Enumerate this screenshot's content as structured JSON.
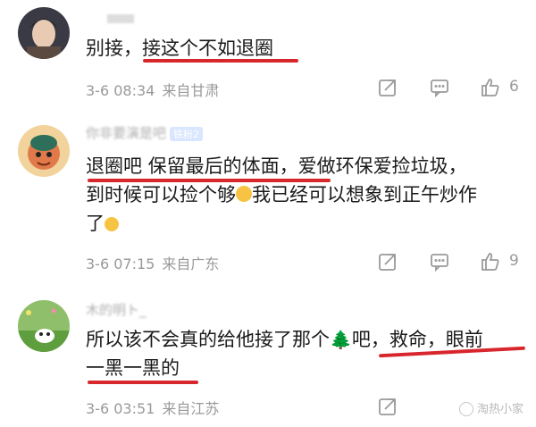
{
  "comments": [
    {
      "username": "",
      "text": "别接，接这个不如退圈",
      "time": "3-6 08:34",
      "location": "来自甘肃",
      "likes": "6"
    },
    {
      "username": "你非要演是吧",
      "badge": "铁粉2",
      "text_line1": "退圈吧  保留最后的体面，爱做环保爱捡垃圾，",
      "text_line2": "到时候可以捡个够",
      "text_line2b": "我已经可以想象到正午炒作",
      "text_line3": "了",
      "time": "3-6 07:15",
      "location": "来自广东",
      "likes": "9"
    },
    {
      "username": "木的明ト_",
      "text_line1a": "所以该不会真的给他接了那个",
      "text_line1b": "吧，救命，眼前",
      "text_line2": "一黑一黑的",
      "time": "3-6 03:51",
      "location": "来自江苏",
      "likes": ""
    }
  ],
  "watermark": "淘热小家",
  "icons": [
    "share-icon",
    "comment-icon",
    "like-icon"
  ],
  "colors": {
    "underline": "#d8262d",
    "meta": "#999999"
  }
}
